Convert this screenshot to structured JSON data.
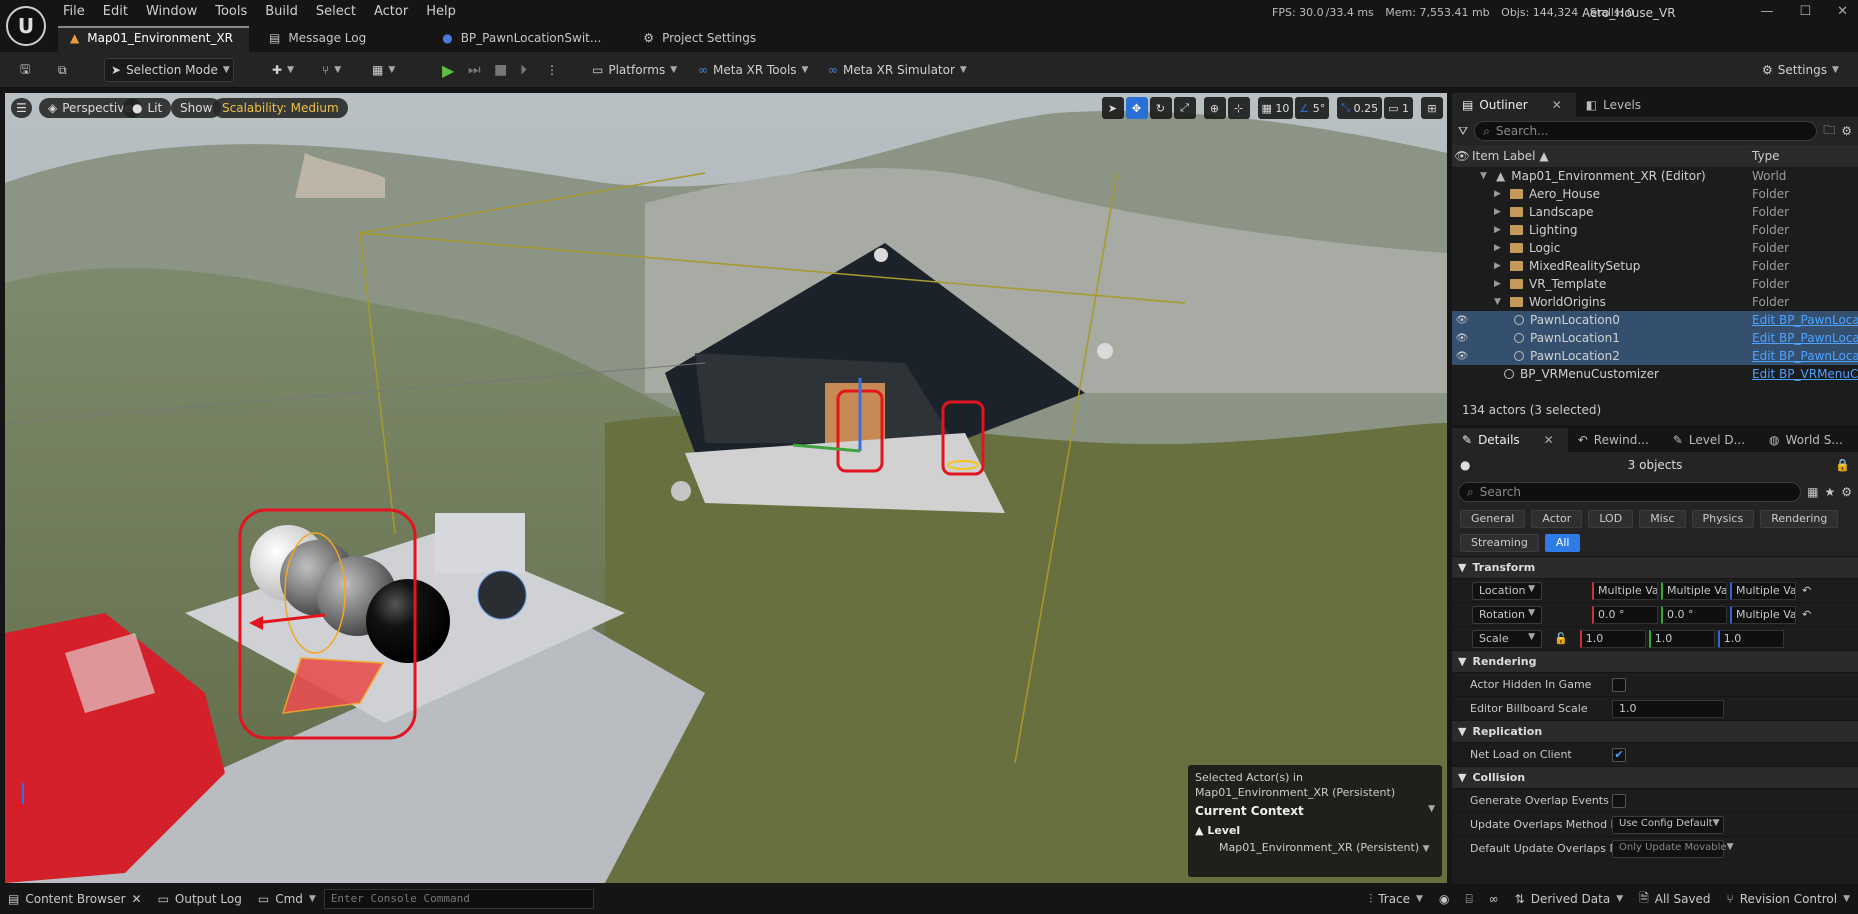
{
  "menu": [
    "File",
    "Edit",
    "Window",
    "Tools",
    "Build",
    "Select",
    "Actor",
    "Help"
  ],
  "stats": {
    "fps": "FPS: 30.0",
    "ms": "/33.4 ms",
    "mem": "Mem: 7,553.41 mb",
    "objs": "Objs: 144,324",
    "stalls": "Stalls: 0"
  },
  "project_name": "Aero_House_VR",
  "doc_tabs": [
    "Map01_Environment_XR",
    "Message Log",
    "BP_PawnLocationSwit...",
    "Project Settings"
  ],
  "toolbar": {
    "selection_mode": "Selection Mode",
    "platforms": "Platforms",
    "meta_xr_tools": "Meta XR Tools",
    "meta_xr_simulator": "Meta XR Simulator",
    "settings": "Settings"
  },
  "viewport": {
    "perspective": "Perspective",
    "lit": "Lit",
    "show": "Show",
    "scalability": "Scalability: Medium",
    "grid_size": "10",
    "rot_snap": "5°",
    "scale_snap": "0.25",
    "camera_speed": "1",
    "context": {
      "line1": "Selected Actor(s) in",
      "line2": "Map01_Environment_XR (Persistent)",
      "current_context": "Current Context",
      "level_label": "Level",
      "level_name": "Map01_Environment_XR (Persistent)"
    }
  },
  "outliner": {
    "tab_outliner": "Outliner",
    "tab_levels": "Levels",
    "search_placeholder": "Search...",
    "col_label": "Item Label",
    "col_type": "Type",
    "rows": [
      {
        "label": "Map01_Environment_XR (Editor)",
        "type": "World"
      },
      {
        "label": "Aero_House",
        "type": "Folder"
      },
      {
        "label": "Landscape",
        "type": "Folder"
      },
      {
        "label": "Lighting",
        "type": "Folder"
      },
      {
        "label": "Logic",
        "type": "Folder"
      },
      {
        "label": "MixedRealitySetup",
        "type": "Folder"
      },
      {
        "label": "VR_Template",
        "type": "Folder"
      },
      {
        "label": "WorldOrigins",
        "type": "Folder"
      },
      {
        "label": "PawnLocation0",
        "type": "Edit BP_PawnLoca"
      },
      {
        "label": "PawnLocation1",
        "type": "Edit BP_PawnLoca"
      },
      {
        "label": "PawnLocation2",
        "type": "Edit BP_PawnLoca"
      },
      {
        "label": "BP_VRMenuCustomizer",
        "type": "Edit BP_VRMenuCu"
      }
    ],
    "actor_count": "134 actors (3 selected)"
  },
  "details": {
    "tabs": [
      "Details",
      "Rewind...",
      "Level D...",
      "World S..."
    ],
    "objects": "3 objects",
    "search_placeholder": "Search",
    "filters": [
      "General",
      "Actor",
      "LOD",
      "Misc",
      "Physics",
      "Rendering",
      "Streaming",
      "All"
    ],
    "transform": {
      "section": "Transform",
      "location_label": "Location",
      "location": [
        "Multiple Va",
        "Multiple Va",
        "Multiple Va"
      ],
      "rotation_label": "Rotation",
      "rotation": [
        "0.0 °",
        "0.0 °",
        "Multiple Va"
      ],
      "scale_label": "Scale",
      "scale": [
        "1.0",
        "1.0",
        "1.0"
      ]
    },
    "rendering": {
      "section": "Rendering",
      "hidden": "Actor Hidden In Game",
      "billboard": "Editor Billboard Scale",
      "billboard_val": "1.0"
    },
    "replication": {
      "section": "Replication",
      "net_load": "Net Load on Client"
    },
    "collision": {
      "section": "Collision",
      "overlap": "Generate Overlap Events Du...",
      "method": "Update Overlaps Method D...",
      "method_val": "Use Config Default",
      "default": "Default Update Overlaps M...",
      "default_val": "Only Update Movable"
    }
  },
  "statusbar": {
    "content_browser": "Content Browser",
    "output_log": "Output Log",
    "cmd": "Cmd",
    "console_placeholder": "Enter Console Command",
    "trace": "Trace",
    "derived_data": "Derived Data",
    "all_saved": "All Saved",
    "revision_control": "Revision Control"
  }
}
